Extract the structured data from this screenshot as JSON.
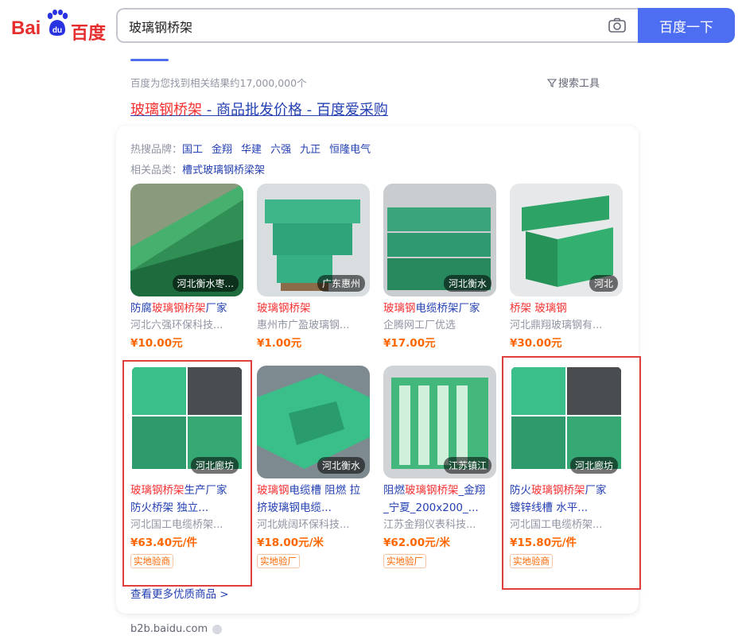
{
  "logo": {
    "bai": "Bai",
    "du": "du",
    "baidu_cn": "百度"
  },
  "search": {
    "query": "玻璃钢桥架",
    "button": "百度一下"
  },
  "results": {
    "count_text": "百度为您找到相关结果约17,000,000个",
    "tools_label": "搜索工具"
  },
  "result": {
    "title_hl": "玻璃钢桥架",
    "title_rest": " - 商品批发价格 - 百度爱采购",
    "hot_brands_label": "热搜品牌：",
    "hot_brands": [
      "国工",
      "金翔",
      "华建",
      "六强",
      "九正",
      "恒隆电气"
    ],
    "categories_label": "相关品类：",
    "categories": [
      "槽式玻璃钢桥梁架"
    ],
    "products": [
      {
        "title_pre": "防腐",
        "title_hl": "玻璃钢桥架",
        "title_post": "厂家",
        "seller": "河北六强环保科技...",
        "price": "¥10.00元",
        "location": "河北衡水枣...",
        "badge": ""
      },
      {
        "title_pre": "",
        "title_hl": "玻璃钢桥架",
        "title_post": "",
        "seller": "惠州市广盈玻璃钢...",
        "price": "¥1.00元",
        "location": "广东惠州",
        "badge": ""
      },
      {
        "title_pre": "",
        "title_hl": "玻璃钢",
        "title_post": "电缆桥架厂家",
        "seller": "企腾网工厂优选",
        "price": "¥17.00元",
        "location": "河北衡水",
        "badge": ""
      },
      {
        "title_pre": "",
        "title_hl": "桥架 玻璃钢",
        "title_post": "",
        "seller": "河北鼎翔玻璃钢有...",
        "price": "¥30.00元",
        "location": "河北",
        "badge": ""
      },
      {
        "title_pre": "",
        "title_hl": "玻璃钢桥架",
        "title_post": "生产厂家",
        "title_line2": "防火桥架 独立...",
        "seller": "河北国工电缆桥架...",
        "price": "¥63.40元/件",
        "location": "河北廊坊",
        "badge": "实地验商"
      },
      {
        "title_pre": "",
        "title_hl": "玻璃钢",
        "title_post": "电缆槽 阻燃 拉",
        "title_line2": "挤玻璃钢电缆...",
        "seller": "河北姚阔环保科技...",
        "price": "¥18.00元/米",
        "location": "河北衡水",
        "badge": "实地验厂"
      },
      {
        "title_pre": "阻燃",
        "title_hl": "玻璃钢桥架",
        "title_post": "_金翔",
        "title_line2": "_宁夏_200x200_...",
        "seller": "江苏金翔仪表科技...",
        "price": "¥62.00元/米",
        "location": "江苏镇江",
        "badge": "实地验厂"
      },
      {
        "title_pre": "防火",
        "title_hl": "玻璃钢桥架",
        "title_post": "厂家",
        "title_line2": "镀锌线槽 水平...",
        "seller": "河北国工电缆桥架...",
        "price": "¥15.80元/件",
        "location": "河北廊坊",
        "badge": "实地验商"
      }
    ],
    "more_link": "查看更多优质商品 >",
    "source": "b2b.baidu.com"
  },
  "colors": {
    "accent": "#4e6ef2",
    "link": "#2440b3",
    "highlight": "#f73131",
    "price": "#ff6600",
    "product_green": "#2e9e6a",
    "annotation_red": "#e0403d"
  }
}
